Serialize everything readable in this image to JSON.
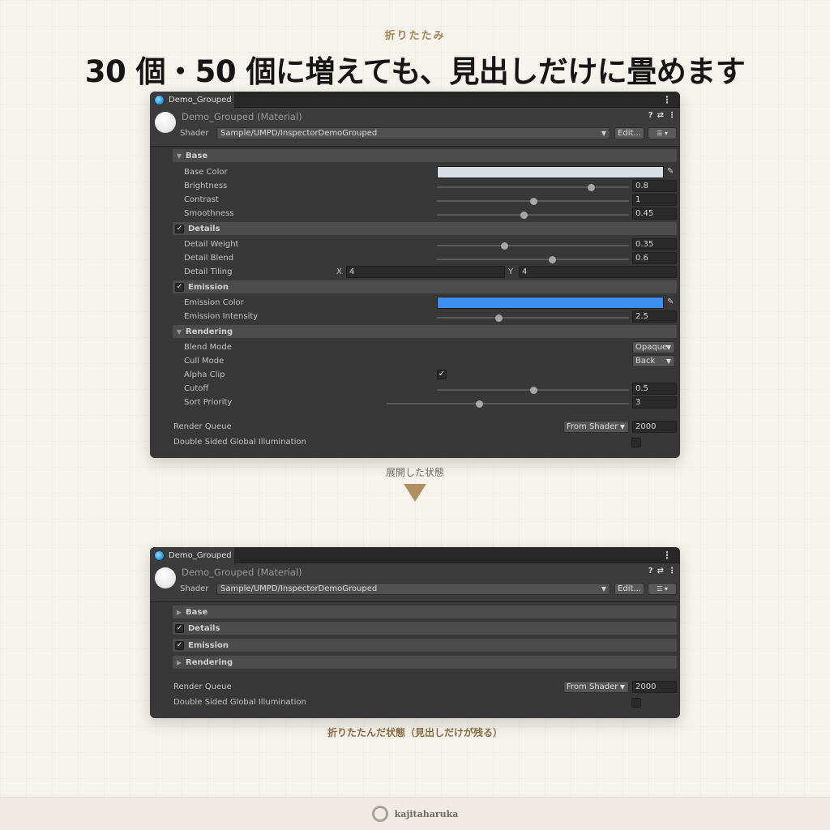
{
  "kicker": "折りたたみ",
  "headline": "30 個・50 個に増えても、見出しだけに畳めます",
  "inspector": {
    "tab_title": "Demo_Grouped",
    "menu_icon": "kebab-menu-icon",
    "material_name": "Demo_Grouped (Material)",
    "header_icons": [
      "?",
      "⇄",
      "⋮"
    ],
    "shader_label": "Shader",
    "shader_value": "Sample/UMPD/InspectorDemoGrouped",
    "edit_label": "Edit...",
    "list_label": "☰ ▾"
  },
  "expanded": {
    "groups": {
      "base": "Base",
      "details": "Details",
      "emission": "Emission",
      "rendering": "Rendering"
    },
    "props": {
      "base_color": "Base Color",
      "brightness": "Brightness",
      "brightness_value": "0.8",
      "brightness_level": 0.8,
      "contrast": "Contrast",
      "contrast_value": "1",
      "contrast_level": 0.5,
      "smoothness": "Smoothness",
      "smoothness_value": "0.45",
      "smoothness_level": 0.45,
      "detail_weight": "Detail Weight",
      "detail_weight_value": "0.35",
      "detail_weight_level": 0.35,
      "detail_blend": "Detail Blend",
      "detail_blend_value": "0.6",
      "detail_blend_level": 0.6,
      "detail_tiling": "Detail Tiling",
      "x_label": "X",
      "x_value": "4",
      "y_label": "Y",
      "y_value": "4",
      "emission_color": "Emission Color",
      "emission_intensity": "Emission Intensity",
      "emission_intensity_value": "2.5",
      "emission_intensity_level": 0.32,
      "blend_mode": "Blend Mode",
      "blend_mode_value": "Opaque",
      "cull_mode": "Cull Mode",
      "cull_mode_value": "Back",
      "alpha_clip": "Alpha Clip",
      "cutoff": "Cutoff",
      "cutoff_value": "0.5",
      "cutoff_level": 0.5,
      "sort_priority": "Sort Priority",
      "sort_priority_value": "3",
      "sort_priority_level": 0.38
    },
    "colors": {
      "base": "#d9dde4",
      "emission": "#3f8ff0"
    }
  },
  "common": {
    "render_queue": "Render Queue",
    "render_queue_mode": "From Shader",
    "render_queue_value": "2000",
    "double_sided_gi": "Double Sided Global Illumination"
  },
  "caption_expanded": "展開した状態",
  "caption_collapsed": "折りたたんだ状態（見出しだけが残る）",
  "brand": "kajitaharuka"
}
